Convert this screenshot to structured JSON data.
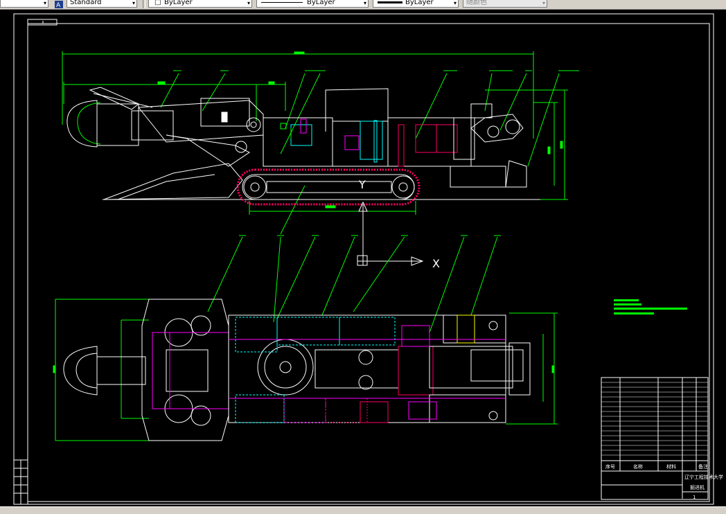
{
  "toolbar": {
    "layer_arrow": "▾",
    "style_value": "Standard",
    "color_value": "ByLayer",
    "linetype_value": "ByLayer",
    "lineweight_value": "ByLayer",
    "plotstyle_value": "随颜色"
  },
  "ucs": {
    "x_label": "X",
    "y_label": "Y"
  },
  "title_block": {
    "school": "辽宁工程技术大学",
    "drawing_name": "掘进机",
    "sheet": "1",
    "col_seq": "序号",
    "col_name": "名称",
    "col_material": "材料",
    "col_note": "备注"
  },
  "colors": {
    "background": "#000000",
    "frame": "#ffffff",
    "machine": "#ffffff",
    "dimension": "#00ff00",
    "highlight": "#ff0066",
    "accent_cyan": "#00ffff",
    "accent_magenta": "#ff00ff"
  }
}
